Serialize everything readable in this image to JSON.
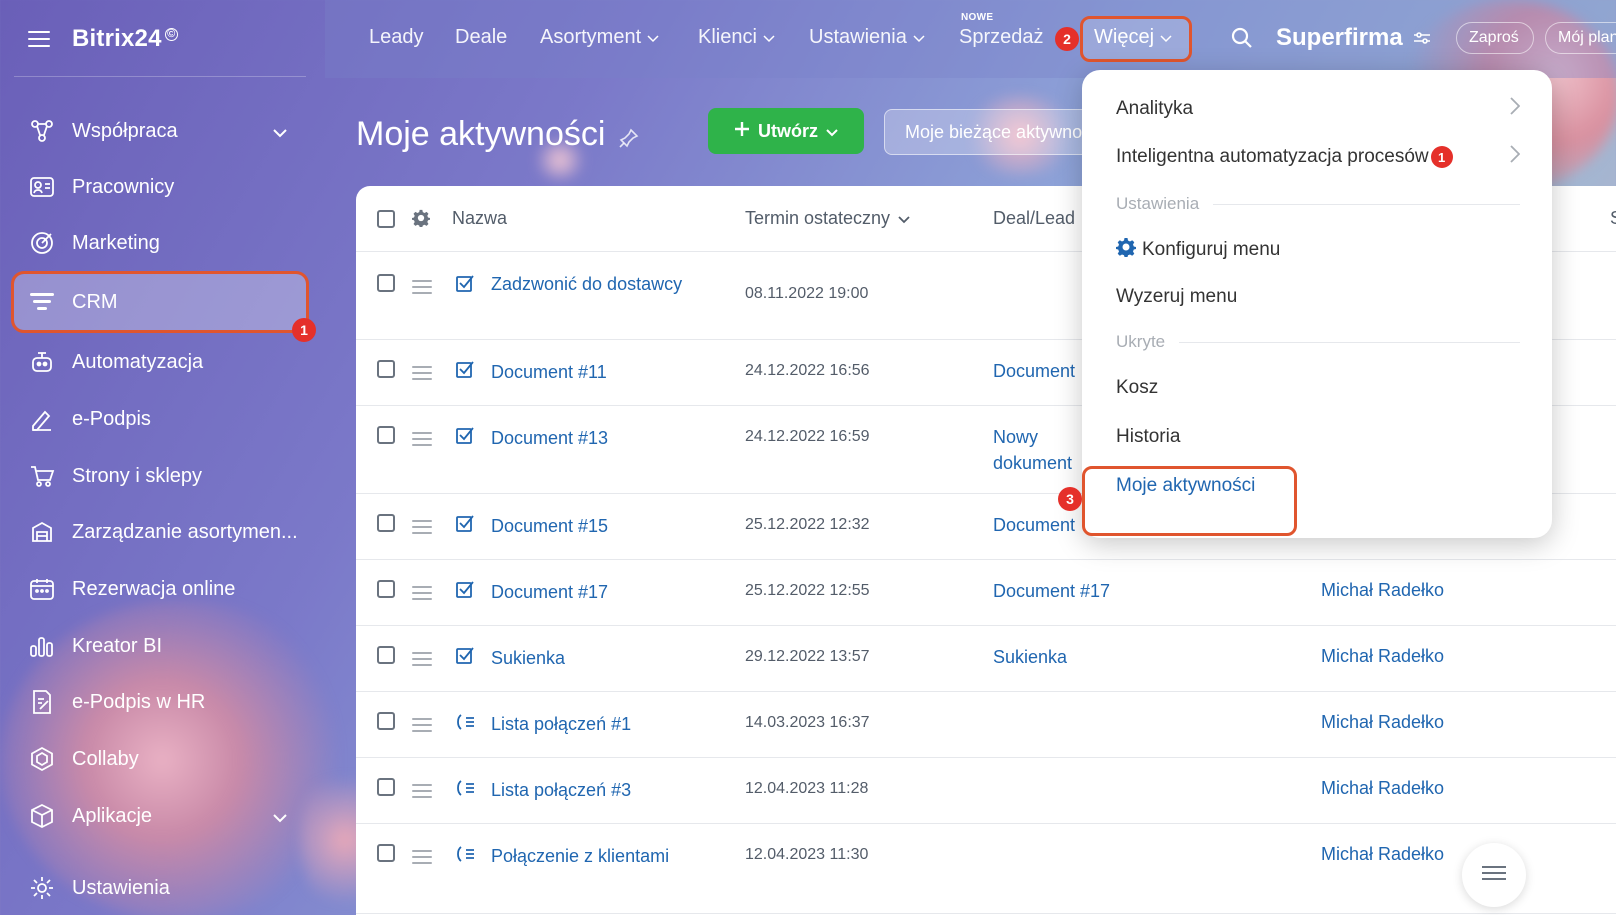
{
  "sidebar": {
    "logo": "Bitrix24",
    "logo_mark": "©",
    "items": [
      {
        "label": "Współpraca",
        "icon": "collaboration-icon",
        "has_chevron": true
      },
      {
        "label": "Pracownicy",
        "icon": "employees-icon"
      },
      {
        "label": "Marketing",
        "icon": "marketing-icon"
      },
      {
        "label": "CRM",
        "icon": "crm-funnel-icon",
        "active": true
      },
      {
        "label": "Automatyzacja",
        "icon": "automation-robot-icon"
      },
      {
        "label": "e-Podpis",
        "icon": "e-signature-icon"
      },
      {
        "label": "Strony i sklepy",
        "icon": "shopping-cart-icon"
      },
      {
        "label": "Zarządzanie asortymen...",
        "icon": "inventory-icon"
      },
      {
        "label": "Rezerwacja online",
        "icon": "calendar-booking-icon"
      },
      {
        "label": "Kreator BI",
        "icon": "bar-chart-icon"
      },
      {
        "label": "e-Podpis w HR",
        "icon": "hr-signature-icon"
      },
      {
        "label": "Collaby",
        "icon": "collaby-hexagon-icon"
      },
      {
        "label": "Aplikacje",
        "icon": "apps-cube-icon",
        "has_chevron": true
      },
      {
        "label": "Ustawienia",
        "icon": "settings-gear-icon"
      }
    ]
  },
  "step_badges": {
    "one": "1",
    "two": "2",
    "three": "3"
  },
  "topnav": {
    "items": [
      "Leady",
      "Deale",
      "Asortyment",
      "Klienci",
      "Ustawienia",
      "Sprzedaż"
    ],
    "new_label": "NOWE",
    "more_label": "Więcej",
    "company": "Superfirma",
    "invite": "Zaproś",
    "my_plan": "Mój plan"
  },
  "page": {
    "title": "Moje aktywności",
    "create_button": "Utwórz",
    "filter_text": "Moje bieżące aktywności"
  },
  "grid": {
    "columns": {
      "name": "Nazwa",
      "deadline": "Termin ostateczny",
      "deal": "Deal/Lead",
      "extra": "S"
    },
    "rows": [
      {
        "type": "task",
        "name": "Zadzwonić do dostawcy",
        "date": "08.11.2022 19:00",
        "deal": "",
        "person": ""
      },
      {
        "type": "task",
        "name": "Document #11",
        "date": "24.12.2022 16:56",
        "deal": "Document",
        "person": ""
      },
      {
        "type": "task",
        "name": "Document #13",
        "date": "24.12.2022 16:59",
        "deal": "Nowy dokument",
        "person": ""
      },
      {
        "type": "task",
        "name": "Document #15",
        "date": "25.12.2022 12:32",
        "deal": "Document",
        "person": ""
      },
      {
        "type": "task",
        "name": "Document #17",
        "date": "25.12.2022 12:55",
        "deal": "Document #17",
        "person": "Michał Radełko"
      },
      {
        "type": "task",
        "name": "Sukienka",
        "date": "29.12.2022 13:57",
        "deal": "Sukienka",
        "person": "Michał Radełko"
      },
      {
        "type": "call",
        "name": "Lista połączeń #1",
        "date": "14.03.2023 16:37",
        "deal": "",
        "person": "Michał Radełko"
      },
      {
        "type": "call",
        "name": "Lista połączeń #3",
        "date": "12.04.2023 11:28",
        "deal": "",
        "person": "Michał Radełko"
      },
      {
        "type": "call",
        "name": "Połączenie z klientami",
        "date": "12.04.2023 11:30",
        "deal": "",
        "person": "Michał Radełko"
      }
    ]
  },
  "dropdown": {
    "analytics": "Analityka",
    "automation": "Inteligentna automatyzacja procesów",
    "automation_badge": "1",
    "section_settings": "Ustawienia",
    "configure": "Konfiguruj menu",
    "reset": "Wyzeruj menu",
    "section_hidden": "Ukryte",
    "trash": "Kosz",
    "history": "Historia",
    "my_activities": "Moje aktywności"
  },
  "colors": {
    "accent_link": "#2066b0",
    "create_green": "#2fb34a",
    "highlight_orange": "#e0552e",
    "badge_red": "#e5302a"
  }
}
